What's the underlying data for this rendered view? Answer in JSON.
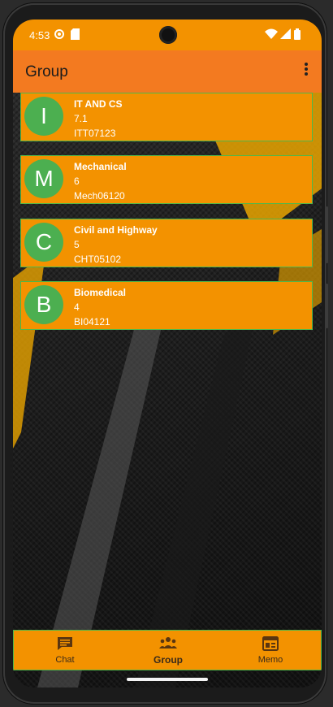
{
  "status_bar": {
    "time": "4:53"
  },
  "app_bar": {
    "title": "Group"
  },
  "groups": [
    {
      "initial": "I",
      "name": "IT AND CS",
      "number": "7.1",
      "code": "ITT07123"
    },
    {
      "initial": "M",
      "name": "Mechanical",
      "number": "6",
      "code": "Mech06120"
    },
    {
      "initial": "C",
      "name": "Civil and Highway",
      "number": "5",
      "code": "CHT05102"
    },
    {
      "initial": "B",
      "name": "Biomedical",
      "number": "4",
      "code": "BI04121"
    }
  ],
  "bottom_nav": [
    {
      "label": "Chat",
      "icon": "chat-icon",
      "active": false
    },
    {
      "label": "Group",
      "icon": "group-icon",
      "active": true
    },
    {
      "label": "Memo",
      "icon": "memo-icon",
      "active": false
    }
  ],
  "colors": {
    "status_bar": "#f39200",
    "app_bar": "#f37a20",
    "card": "#f39200",
    "card_border": "#4fb84a",
    "avatar": "#4caf50"
  }
}
